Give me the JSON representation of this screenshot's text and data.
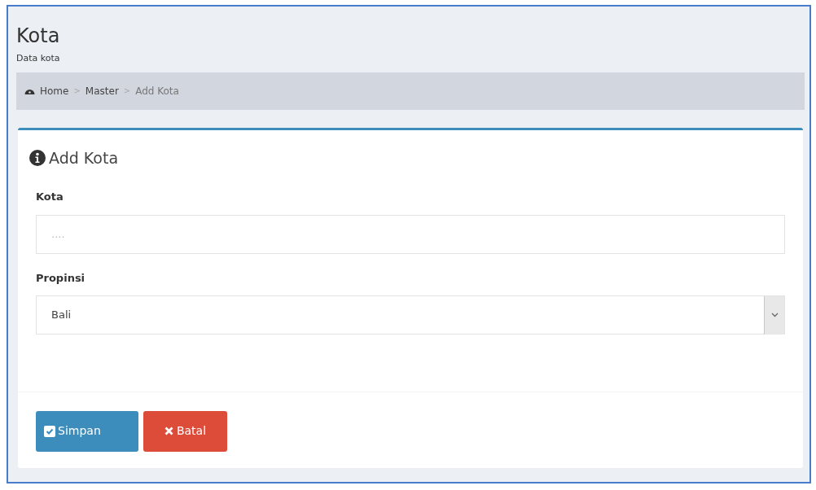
{
  "header": {
    "title": "Kota",
    "subtitle": "Data kota"
  },
  "breadcrumb": [
    {
      "label": "Home"
    },
    {
      "label": "Master"
    },
    {
      "label": "Add Kota"
    }
  ],
  "breadcrumb_separator": ">",
  "card": {
    "title": "Add Kota",
    "fields": [
      {
        "kind": "text",
        "label": "Kota",
        "placeholder": "...."
      },
      {
        "kind": "select",
        "label": "Propinsi",
        "value": "Bali"
      }
    ],
    "buttons": [
      {
        "kind": "save",
        "label": "Simpan"
      },
      {
        "kind": "cancel",
        "label": "Batal"
      }
    ]
  }
}
